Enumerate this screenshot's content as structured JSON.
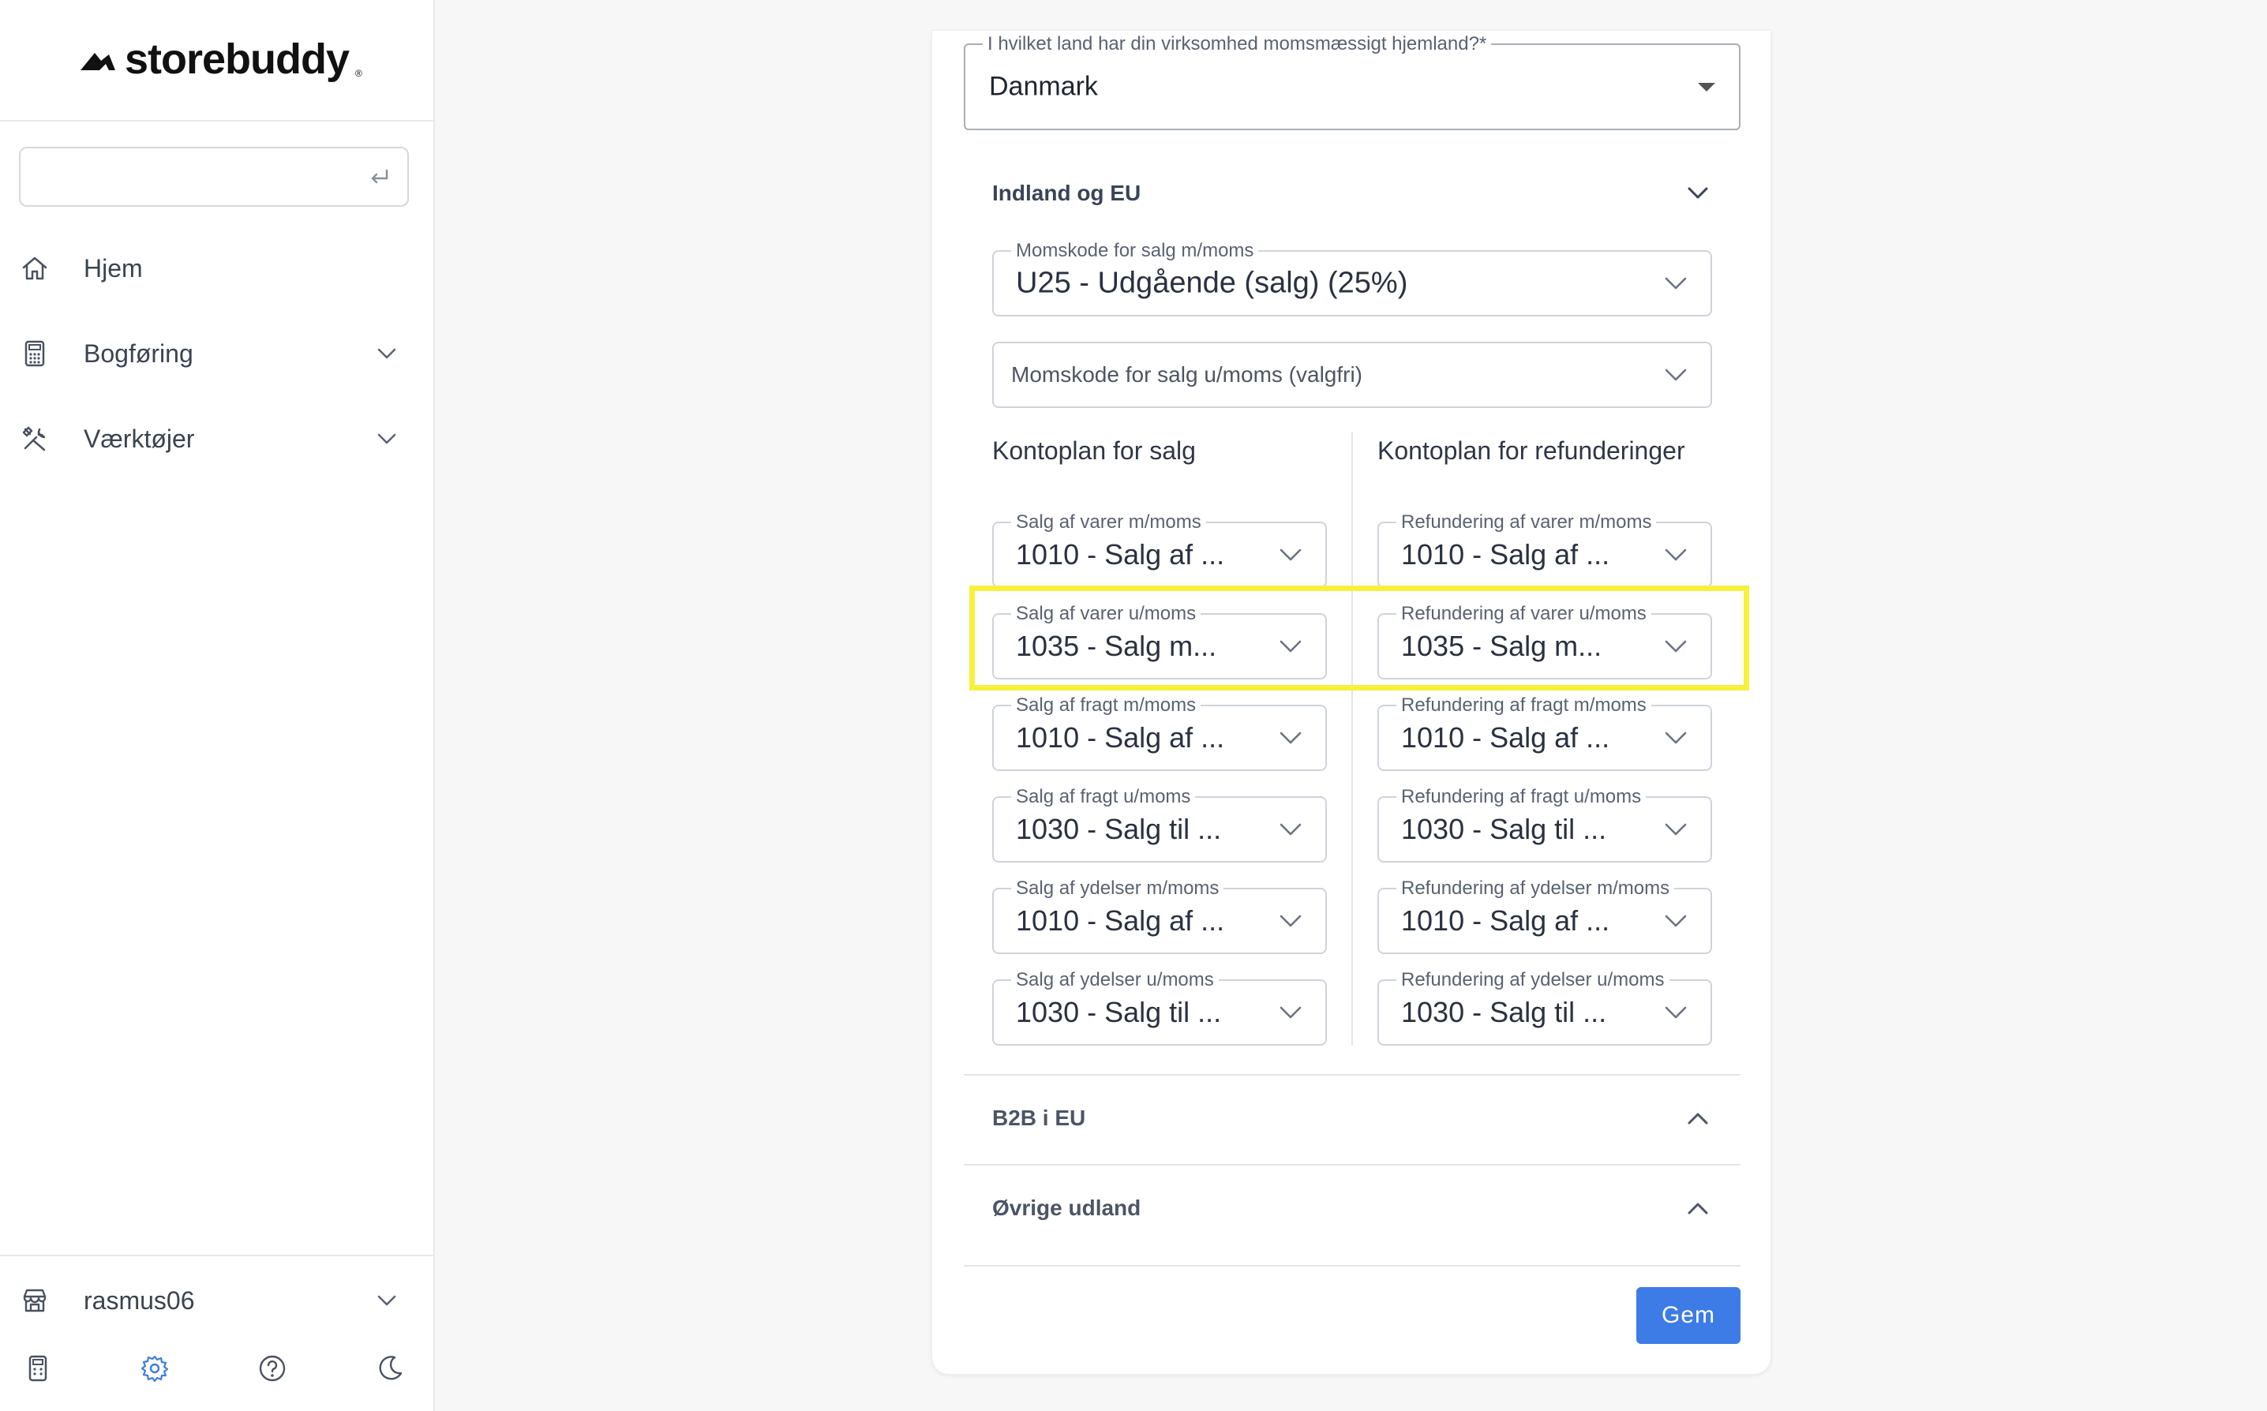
{
  "sidebar": {
    "logo_text": "storebuddy",
    "logo_reg": "®",
    "search": {
      "value": "",
      "placeholder": ""
    },
    "nav": [
      {
        "label": "Hjem",
        "icon": "home-icon"
      },
      {
        "label": "Bogføring",
        "icon": "calculator-icon",
        "expandable": true
      },
      {
        "label": "Værktøjer",
        "icon": "tools-icon",
        "expandable": true
      }
    ],
    "account": {
      "label": "rasmus06",
      "icon": "store-icon"
    },
    "bottom_icons": [
      "calculator-icon",
      "gear-icon",
      "help-icon",
      "moon-icon"
    ],
    "active_bottom_icon": "gear-icon",
    "accent_color": "#3d7be6"
  },
  "form": {
    "country": {
      "label": "I hvilket land har din virksomhed momsmæssigt hjemland?*",
      "value": "Danmark"
    },
    "sections": {
      "domestic_eu": {
        "title": "Indland og EU",
        "expanded": true,
        "vat_with": {
          "label": "Momskode for salg m/moms",
          "value": "U25 - Udgående (salg) (25%)"
        },
        "vat_without": {
          "placeholder": "Momskode for salg u/moms (valgfri)"
        },
        "sales_title": "Kontoplan for salg",
        "refunds_title": "Kontoplan for refunderinger",
        "sales": [
          {
            "label": "Salg af varer m/moms",
            "value": "1010 - Salg af ..."
          },
          {
            "label": "Salg af varer u/moms",
            "value": "1035 - Salg m..."
          },
          {
            "label": "Salg af fragt m/moms",
            "value": "1010 - Salg af ..."
          },
          {
            "label": "Salg af fragt u/moms",
            "value": "1030 - Salg til ..."
          },
          {
            "label": "Salg af ydelser m/moms",
            "value": "1010 - Salg af ..."
          },
          {
            "label": "Salg af ydelser u/moms",
            "value": "1030 - Salg til ..."
          }
        ],
        "refunds": [
          {
            "label": "Refundering af varer m/moms",
            "value": "1010 - Salg af ..."
          },
          {
            "label": "Refundering af varer u/moms",
            "value": "1035 - Salg m..."
          },
          {
            "label": "Refundering af fragt m/moms",
            "value": "1010 - Salg af ..."
          },
          {
            "label": "Refundering af fragt u/moms",
            "value": "1030 - Salg til ..."
          },
          {
            "label": "Refundering af ydelser m/moms",
            "value": "1010 - Salg af ..."
          },
          {
            "label": "Refundering af ydelser u/moms",
            "value": "1030 - Salg til ..."
          }
        ]
      },
      "b2b_eu": {
        "title": "B2B i EU",
        "expanded": false
      },
      "other_abroad": {
        "title": "Øvrige udland",
        "expanded": false
      }
    },
    "save_label": "Gem"
  },
  "highlight_color": "#f7f13b"
}
